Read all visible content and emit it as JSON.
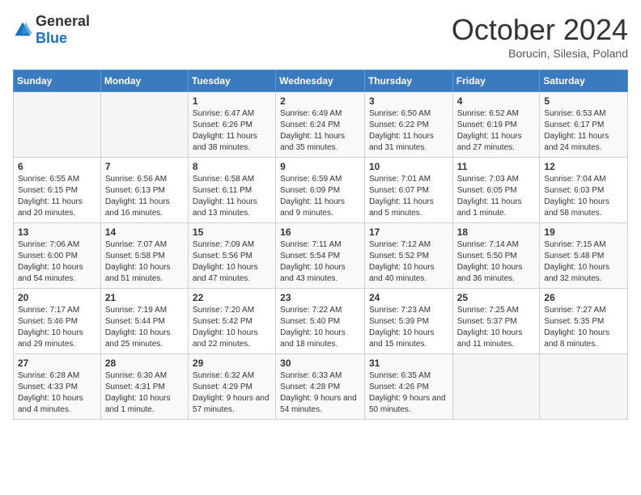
{
  "header": {
    "logo_general": "General",
    "logo_blue": "Blue",
    "month_title": "October 2024",
    "subtitle": "Borucin, Silesia, Poland"
  },
  "weekdays": [
    "Sunday",
    "Monday",
    "Tuesday",
    "Wednesday",
    "Thursday",
    "Friday",
    "Saturday"
  ],
  "weeks": [
    [
      {
        "day": "",
        "info": ""
      },
      {
        "day": "",
        "info": ""
      },
      {
        "day": "1",
        "info": "Sunrise: 6:47 AM\nSunset: 6:26 PM\nDaylight: 11 hours and 38 minutes."
      },
      {
        "day": "2",
        "info": "Sunrise: 6:49 AM\nSunset: 6:24 PM\nDaylight: 11 hours and 35 minutes."
      },
      {
        "day": "3",
        "info": "Sunrise: 6:50 AM\nSunset: 6:22 PM\nDaylight: 11 hours and 31 minutes."
      },
      {
        "day": "4",
        "info": "Sunrise: 6:52 AM\nSunset: 6:19 PM\nDaylight: 11 hours and 27 minutes."
      },
      {
        "day": "5",
        "info": "Sunrise: 6:53 AM\nSunset: 6:17 PM\nDaylight: 11 hours and 24 minutes."
      }
    ],
    [
      {
        "day": "6",
        "info": "Sunrise: 6:55 AM\nSunset: 6:15 PM\nDaylight: 11 hours and 20 minutes."
      },
      {
        "day": "7",
        "info": "Sunrise: 6:56 AM\nSunset: 6:13 PM\nDaylight: 11 hours and 16 minutes."
      },
      {
        "day": "8",
        "info": "Sunrise: 6:58 AM\nSunset: 6:11 PM\nDaylight: 11 hours and 13 minutes."
      },
      {
        "day": "9",
        "info": "Sunrise: 6:59 AM\nSunset: 6:09 PM\nDaylight: 11 hours and 9 minutes."
      },
      {
        "day": "10",
        "info": "Sunrise: 7:01 AM\nSunset: 6:07 PM\nDaylight: 11 hours and 5 minutes."
      },
      {
        "day": "11",
        "info": "Sunrise: 7:03 AM\nSunset: 6:05 PM\nDaylight: 11 hours and 1 minute."
      },
      {
        "day": "12",
        "info": "Sunrise: 7:04 AM\nSunset: 6:03 PM\nDaylight: 10 hours and 58 minutes."
      }
    ],
    [
      {
        "day": "13",
        "info": "Sunrise: 7:06 AM\nSunset: 6:00 PM\nDaylight: 10 hours and 54 minutes."
      },
      {
        "day": "14",
        "info": "Sunrise: 7:07 AM\nSunset: 5:58 PM\nDaylight: 10 hours and 51 minutes."
      },
      {
        "day": "15",
        "info": "Sunrise: 7:09 AM\nSunset: 5:56 PM\nDaylight: 10 hours and 47 minutes."
      },
      {
        "day": "16",
        "info": "Sunrise: 7:11 AM\nSunset: 5:54 PM\nDaylight: 10 hours and 43 minutes."
      },
      {
        "day": "17",
        "info": "Sunrise: 7:12 AM\nSunset: 5:52 PM\nDaylight: 10 hours and 40 minutes."
      },
      {
        "day": "18",
        "info": "Sunrise: 7:14 AM\nSunset: 5:50 PM\nDaylight: 10 hours and 36 minutes."
      },
      {
        "day": "19",
        "info": "Sunrise: 7:15 AM\nSunset: 5:48 PM\nDaylight: 10 hours and 32 minutes."
      }
    ],
    [
      {
        "day": "20",
        "info": "Sunrise: 7:17 AM\nSunset: 5:46 PM\nDaylight: 10 hours and 29 minutes."
      },
      {
        "day": "21",
        "info": "Sunrise: 7:19 AM\nSunset: 5:44 PM\nDaylight: 10 hours and 25 minutes."
      },
      {
        "day": "22",
        "info": "Sunrise: 7:20 AM\nSunset: 5:42 PM\nDaylight: 10 hours and 22 minutes."
      },
      {
        "day": "23",
        "info": "Sunrise: 7:22 AM\nSunset: 5:40 PM\nDaylight: 10 hours and 18 minutes."
      },
      {
        "day": "24",
        "info": "Sunrise: 7:23 AM\nSunset: 5:39 PM\nDaylight: 10 hours and 15 minutes."
      },
      {
        "day": "25",
        "info": "Sunrise: 7:25 AM\nSunset: 5:37 PM\nDaylight: 10 hours and 11 minutes."
      },
      {
        "day": "26",
        "info": "Sunrise: 7:27 AM\nSunset: 5:35 PM\nDaylight: 10 hours and 8 minutes."
      }
    ],
    [
      {
        "day": "27",
        "info": "Sunrise: 6:28 AM\nSunset: 4:33 PM\nDaylight: 10 hours and 4 minutes."
      },
      {
        "day": "28",
        "info": "Sunrise: 6:30 AM\nSunset: 4:31 PM\nDaylight: 10 hours and 1 minute."
      },
      {
        "day": "29",
        "info": "Sunrise: 6:32 AM\nSunset: 4:29 PM\nDaylight: 9 hours and 57 minutes."
      },
      {
        "day": "30",
        "info": "Sunrise: 6:33 AM\nSunset: 4:28 PM\nDaylight: 9 hours and 54 minutes."
      },
      {
        "day": "31",
        "info": "Sunrise: 6:35 AM\nSunset: 4:26 PM\nDaylight: 9 hours and 50 minutes."
      },
      {
        "day": "",
        "info": ""
      },
      {
        "day": "",
        "info": ""
      }
    ]
  ]
}
